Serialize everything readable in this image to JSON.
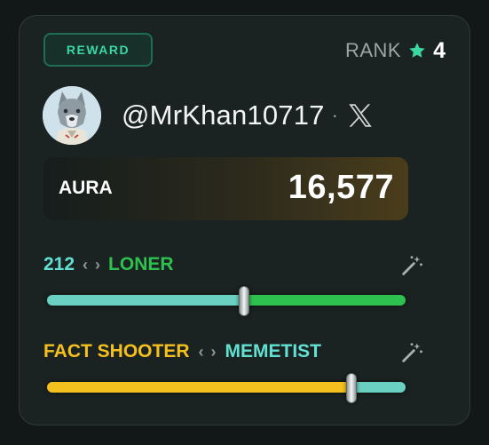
{
  "badge": {
    "label": "REWARD"
  },
  "rank": {
    "label": "RANK",
    "value": "4",
    "icon": "star-icon"
  },
  "profile": {
    "handle": "@MrKhan10717",
    "separator": "·",
    "platform_icon": "x-logo-icon"
  },
  "aura": {
    "label": "AURA",
    "value": "16,577"
  },
  "slider1": {
    "left_label": "212",
    "right_label": "LONER",
    "left_chevron": "‹",
    "right_chevron": "›",
    "position": 0.55,
    "left_color": "#6ad0c2",
    "right_color": "#2fc14f"
  },
  "slider2": {
    "left_label": "FACT SHOOTER",
    "right_label": "MEMETIST",
    "left_chevron": "‹",
    "right_chevron": "›",
    "position": 0.85,
    "left_color": "#f4c01e",
    "right_color": "#6ad0c2"
  },
  "colors": {
    "accent_green": "#3bd7a1",
    "teal": "#62e0d2",
    "green": "#2fc14f",
    "yellow": "#f4c01e"
  }
}
